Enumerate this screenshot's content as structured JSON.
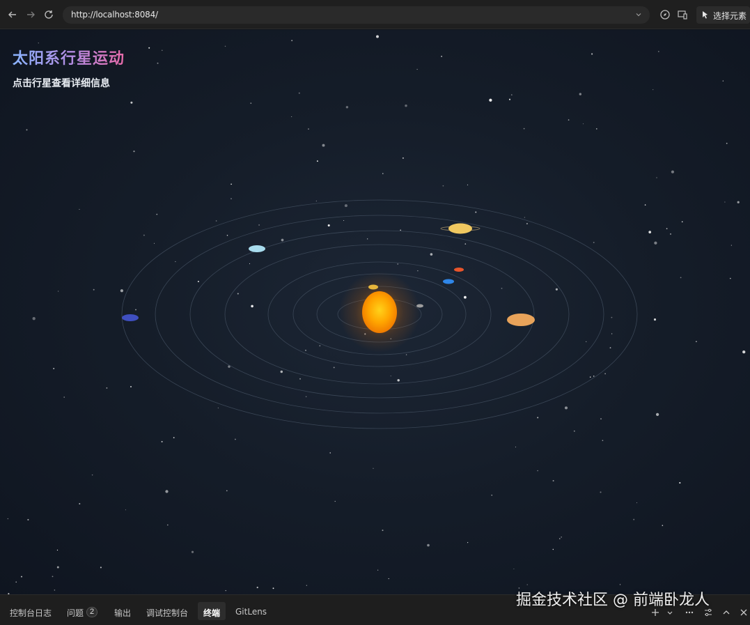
{
  "browser": {
    "url": "http://localhost:8084/",
    "pick_element_label": "选择元素"
  },
  "page": {
    "title": "太阳系行星运动",
    "subtitle": "点击行星查看详细信息",
    "colors": {
      "background": "#151d29",
      "orbit": "#3a4656",
      "sun": "#ff9a00"
    },
    "planets": [
      {
        "name": "mercury",
        "color": "#9e9e9e"
      },
      {
        "name": "venus",
        "color": "#e6b53c"
      },
      {
        "name": "earth",
        "color": "#2f86e8"
      },
      {
        "name": "mars",
        "color": "#e8552b"
      },
      {
        "name": "jupiter",
        "color": "#e8a35a"
      },
      {
        "name": "saturn",
        "color": "#f0c860"
      },
      {
        "name": "uranus",
        "color": "#a8dcee"
      },
      {
        "name": "neptune",
        "color": "#3f4fc0"
      }
    ]
  },
  "panel": {
    "tabs": [
      {
        "label": "控制台日志"
      },
      {
        "label": "问题",
        "count": "2"
      },
      {
        "label": "输出"
      },
      {
        "label": "调试控制台"
      },
      {
        "label": "终端",
        "active": true
      },
      {
        "label": "GitLens"
      }
    ]
  },
  "watermark": "掘金技术社区 @ 前端卧龙人"
}
